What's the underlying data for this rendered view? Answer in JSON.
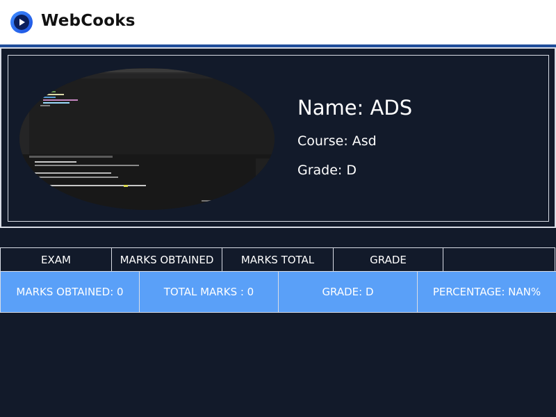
{
  "app": {
    "brand_name": "WebCooks",
    "logo_icon": "play-icon"
  },
  "profile": {
    "name_text": "Name: ADS",
    "course_text": "Course: Asd",
    "grade_text": "Grade: D"
  },
  "table": {
    "headers": [
      "EXAM",
      "MARKS OBTAINED",
      "MARKS TOTAL",
      "GRADE"
    ]
  },
  "summary": {
    "marks_obtained": "MARKS OBTAINED: 0",
    "total_marks": "TOTAL MARKS : 0",
    "grade": "GRADE: D",
    "percentage": "PERCENTAGE: NAN%"
  },
  "colors": {
    "background": "#121a2a",
    "summary_bar": "#5aa0f8",
    "logo": "#2f6fe8",
    "accent_line": "#1f4d9a"
  }
}
